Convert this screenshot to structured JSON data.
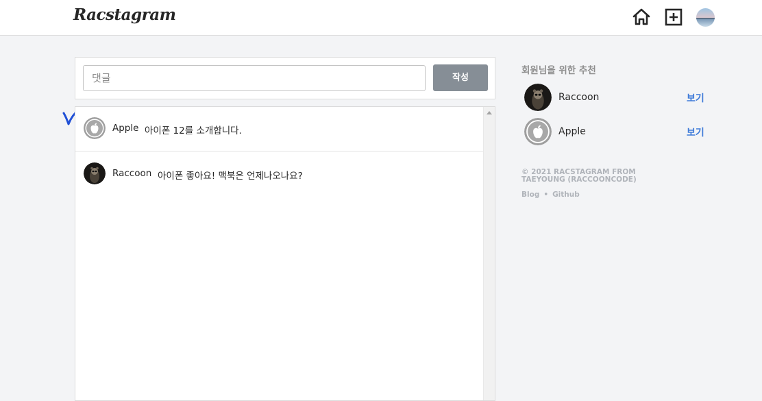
{
  "header": {
    "logo": "Racstagram",
    "icons": [
      "home-icon",
      "add-post-icon",
      "profile-avatar"
    ]
  },
  "comment_form": {
    "placeholder": "댓글",
    "value": "",
    "submit_label": "작성"
  },
  "comments": [
    {
      "user": "Apple",
      "text": "아이폰 12를 소개합니다.",
      "avatar": "apple-logo"
    },
    {
      "user": "Raccoon",
      "text": "아이폰 좋아요! 맥북은 언제나오나요?",
      "avatar": "raccoon-photo"
    }
  ],
  "recommendations": {
    "title": "회원님을 위한 추천",
    "items": [
      {
        "name": "Raccoon",
        "action": "보기",
        "avatar": "raccoon-photo"
      },
      {
        "name": "Apple",
        "action": "보기",
        "avatar": "apple-logo"
      }
    ]
  },
  "footer": {
    "copyright": "© 2021 RACSTAGRAM FROM TAEYOUNG (RACCOONCODE)",
    "links": [
      "Blog",
      "Github"
    ]
  },
  "colors": {
    "page_bg": "#f3f4f6",
    "submit_button": "#868e96",
    "link": "#3f7bd9",
    "annotation_mark": "#1f4fd6"
  }
}
